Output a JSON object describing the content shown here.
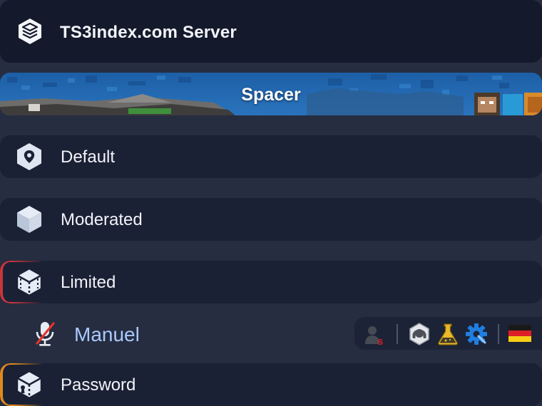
{
  "server": {
    "name": "TS3index.com Server",
    "icon": "server-stack-icon"
  },
  "spacer": {
    "label": "Spacer"
  },
  "channels": [
    {
      "name": "Default",
      "icon": "default-channel-icon"
    },
    {
      "name": "Moderated",
      "icon": "moderated-channel-icon"
    },
    {
      "name": "Limited",
      "icon": "limited-channel-icon",
      "accent": "#c8353a"
    },
    {
      "name": "Password",
      "icon": "password-channel-icon",
      "accent": "#e08a1c"
    }
  ],
  "client": {
    "name": "Manuel",
    "status_icon": "microphone-muted-icon",
    "badges": [
      "server-group-s-icon",
      "headset-support-icon",
      "flask-beta-icon",
      "gear-admin-icon",
      "germany-flag-icon"
    ]
  },
  "colors": {
    "background": "#262d40",
    "row": "#1b2135",
    "client_name": "#a9c9ff",
    "limited_accent": "#c8353a",
    "password_accent": "#e08a1c"
  }
}
